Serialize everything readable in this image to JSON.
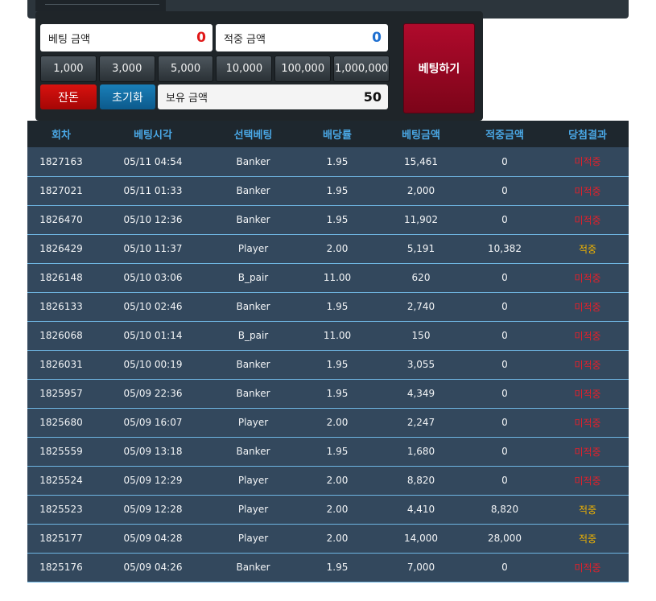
{
  "bet_panel": {
    "bet_amount_label": "베팅 금액",
    "bet_amount_value": "0",
    "win_amount_label": "적중 금액",
    "win_amount_value": "0",
    "chips": [
      "1,000",
      "3,000",
      "5,000",
      "10,000",
      "100,000",
      "1,000,000"
    ],
    "balance_button_label": "잔돈",
    "reset_button_label": "초기화",
    "holding_label": "보유 금액",
    "holding_value": "50",
    "place_bet_label": "베팅하기",
    "colors": {
      "bet_amount": "#e01818",
      "win_amount": "#1e6fd0",
      "balance_button": "#c40c0a",
      "reset_button": "#136da3",
      "place_bet_button": "#9a0725"
    }
  },
  "table": {
    "headers": [
      "회차",
      "베팅시각",
      "선택베팅",
      "배당률",
      "베팅금액",
      "적중금액",
      "당첨결과"
    ],
    "rows": [
      {
        "round": "1827163",
        "time": "05/11 04:54",
        "pick": "Banker",
        "odds": "1.95",
        "bet": "15,461",
        "win": "0",
        "result": "미적중",
        "status": "lose"
      },
      {
        "round": "1827021",
        "time": "05/11 01:33",
        "pick": "Banker",
        "odds": "1.95",
        "bet": "2,000",
        "win": "0",
        "result": "미적중",
        "status": "lose"
      },
      {
        "round": "1826470",
        "time": "05/10 12:36",
        "pick": "Banker",
        "odds": "1.95",
        "bet": "11,902",
        "win": "0",
        "result": "미적중",
        "status": "lose"
      },
      {
        "round": "1826429",
        "time": "05/10 11:37",
        "pick": "Player",
        "odds": "2.00",
        "bet": "5,191",
        "win": "10,382",
        "result": "적중",
        "status": "win"
      },
      {
        "round": "1826148",
        "time": "05/10 03:06",
        "pick": "B_pair",
        "odds": "11.00",
        "bet": "620",
        "win": "0",
        "result": "미적중",
        "status": "lose"
      },
      {
        "round": "1826133",
        "time": "05/10 02:46",
        "pick": "Banker",
        "odds": "1.95",
        "bet": "2,740",
        "win": "0",
        "result": "미적중",
        "status": "lose"
      },
      {
        "round": "1826068",
        "time": "05/10 01:14",
        "pick": "B_pair",
        "odds": "11.00",
        "bet": "150",
        "win": "0",
        "result": "미적중",
        "status": "lose"
      },
      {
        "round": "1826031",
        "time": "05/10 00:19",
        "pick": "Banker",
        "odds": "1.95",
        "bet": "3,055",
        "win": "0",
        "result": "미적중",
        "status": "lose"
      },
      {
        "round": "1825957",
        "time": "05/09 22:36",
        "pick": "Banker",
        "odds": "1.95",
        "bet": "4,349",
        "win": "0",
        "result": "미적중",
        "status": "lose"
      },
      {
        "round": "1825680",
        "time": "05/09 16:07",
        "pick": "Player",
        "odds": "2.00",
        "bet": "2,247",
        "win": "0",
        "result": "미적중",
        "status": "lose"
      },
      {
        "round": "1825559",
        "time": "05/09 13:18",
        "pick": "Banker",
        "odds": "1.95",
        "bet": "1,680",
        "win": "0",
        "result": "미적중",
        "status": "lose"
      },
      {
        "round": "1825524",
        "time": "05/09 12:29",
        "pick": "Player",
        "odds": "2.00",
        "bet": "8,820",
        "win": "0",
        "result": "미적중",
        "status": "lose"
      },
      {
        "round": "1825523",
        "time": "05/09 12:28",
        "pick": "Player",
        "odds": "2.00",
        "bet": "4,410",
        "win": "8,820",
        "result": "적중",
        "status": "win"
      },
      {
        "round": "1825177",
        "time": "05/09 04:28",
        "pick": "Player",
        "odds": "2.00",
        "bet": "14,000",
        "win": "28,000",
        "result": "적중",
        "status": "win"
      },
      {
        "round": "1825176",
        "time": "05/09 04:26",
        "pick": "Banker",
        "odds": "1.95",
        "bet": "7,000",
        "win": "0",
        "result": "미적중",
        "status": "lose"
      }
    ],
    "colors": {
      "header_text": "#4aa8e6",
      "row_background": "#33485d",
      "row_divider": "#6fb6e2",
      "result_lose": "#e3202a",
      "result_win": "#f0b400"
    }
  }
}
